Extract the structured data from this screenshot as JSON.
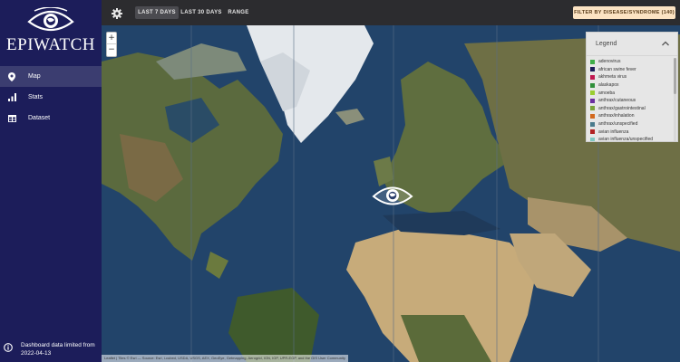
{
  "brand": {
    "name": "EPIWATCH"
  },
  "sidebar": {
    "items": [
      {
        "label": "Map",
        "icon": "map-pin-icon",
        "active": true
      },
      {
        "label": "Stats",
        "icon": "bar-chart-icon",
        "active": false
      },
      {
        "label": "Dataset",
        "icon": "table-icon",
        "active": false
      }
    ],
    "footer": {
      "icon": "info-icon",
      "line1": "Dashboard data limited from",
      "line2": "2022-04-13"
    }
  },
  "topbar": {
    "settings_icon": "gear-icon",
    "ranges": [
      {
        "label": "LAST 7 DAYS",
        "active": true
      },
      {
        "label": "LAST 30 DAYS",
        "active": false
      },
      {
        "label": "RANGE",
        "active": false
      }
    ],
    "filter_label": "FILTER BY DISEASE/SYNDROME (140)"
  },
  "map": {
    "zoom_in": "+",
    "zoom_out": "−",
    "attribution": "Leaflet | Tiles © Esri — Source: Esri, i-cubed, USDA, USGS, AEX, GeoEye, Getmapping, Aerogrid, IGN, IGP, UPR-EGP, and the GIS User Community"
  },
  "legend": {
    "title": "Legend",
    "toggle_icon": "chevron-up-icon",
    "items": [
      {
        "label": "adenovirus",
        "color": "#3fae49"
      },
      {
        "label": "african swine fever",
        "color": "#1c1d5a"
      },
      {
        "label": "akhmeta virus",
        "color": "#c0174f"
      },
      {
        "label": "alaskapox",
        "color": "#2f8f3a"
      },
      {
        "label": "amoeba",
        "color": "#9acd32"
      },
      {
        "label": "anthrax/cutaneous",
        "color": "#6b2fa0"
      },
      {
        "label": "anthrax/gastrointestinal",
        "color": "#7aa33a"
      },
      {
        "label": "anthrax/inhalation",
        "color": "#d2691e"
      },
      {
        "label": "anthrax/unspecified",
        "color": "#4a7b8c"
      },
      {
        "label": "avian influenza",
        "color": "#b22222"
      },
      {
        "label": "avian influenza/unspecified",
        "color": "#7fc8c2"
      }
    ]
  }
}
